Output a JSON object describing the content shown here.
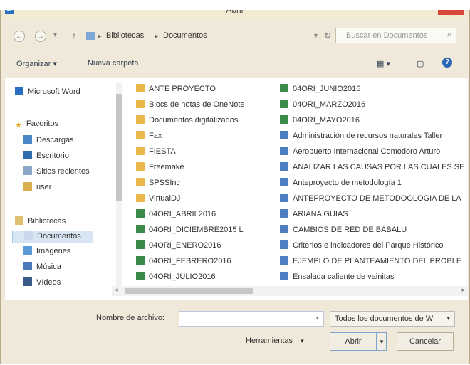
{
  "title": "Abrir",
  "breadcrumb": [
    "Bibliotecas",
    "Documentos"
  ],
  "search_placeholder": "Buscar en Documentos",
  "toolbar": {
    "organize": "Organizar ▾",
    "new_folder": "Nueva carpeta"
  },
  "nav": {
    "items": [
      {
        "label": "Microsoft Word",
        "icon": "word-icon"
      },
      {
        "label": "Favoritos",
        "icon": "star-icon"
      },
      {
        "label": "Descargas",
        "icon": "download-folder-icon"
      },
      {
        "label": "Escritorio",
        "icon": "desktop-icon"
      },
      {
        "label": "Sitios recientes",
        "icon": "recent-places-icon"
      },
      {
        "label": "user",
        "icon": "user-folder-icon"
      },
      {
        "label": "Bibliotecas",
        "icon": "library-icon"
      },
      {
        "label": "Documentos",
        "icon": "documents-icon"
      },
      {
        "label": "Imágenes",
        "icon": "pictures-icon"
      },
      {
        "label": "Música",
        "icon": "music-icon"
      },
      {
        "label": "Vídeos",
        "icon": "videos-icon"
      }
    ]
  },
  "files": {
    "col1": [
      {
        "name": "ANTE PROYECTO",
        "type": "folder"
      },
      {
        "name": "Blocs de notas de OneNote",
        "type": "folder"
      },
      {
        "name": "Documentos digitalizados",
        "type": "folder"
      },
      {
        "name": "Fax",
        "type": "folder"
      },
      {
        "name": "FIESTA",
        "type": "folder"
      },
      {
        "name": "Freemake",
        "type": "folder"
      },
      {
        "name": "SPSSInc",
        "type": "folder"
      },
      {
        "name": "VirtualDJ",
        "type": "folder"
      },
      {
        "name": "04ORI_ABRIL2016",
        "type": "xlsx"
      },
      {
        "name": "04ORI_DICIEMBRE2015 L",
        "type": "xlsx"
      },
      {
        "name": "04ORI_ENERO2016",
        "type": "xlsx"
      },
      {
        "name": "04ORI_FEBRERO2016",
        "type": "xlsx"
      },
      {
        "name": "04ORI_JULIO2016",
        "type": "xlsx"
      }
    ],
    "col2": [
      {
        "name": "04ORI_JUNIO2016",
        "type": "xlsx"
      },
      {
        "name": "04ORI_MARZO2016",
        "type": "xlsx"
      },
      {
        "name": "04ORI_MAYO2016",
        "type": "xlsx"
      },
      {
        "name": "Administración de recursos naturales Taller",
        "type": "docx"
      },
      {
        "name": "Aeropuerto Internacional Comodoro Arturo",
        "type": "docx"
      },
      {
        "name": "ANALIZAR LAS CAUSAS POR LAS CUALES SE",
        "type": "docx"
      },
      {
        "name": "Anteproyecto de metodología 1",
        "type": "docx"
      },
      {
        "name": "ANTEPROYECTO DE METODOOLOGIA DE LA",
        "type": "docx"
      },
      {
        "name": "ARIANA GUIAS",
        "type": "docx"
      },
      {
        "name": "CAMBIOS DE RED DE BABALU",
        "type": "docx"
      },
      {
        "name": "Criterios e indicadores del Parque Histórico",
        "type": "docx"
      },
      {
        "name": "EJEMPLO DE PLANTEAMIENTO DEL PROBLE",
        "type": "docx"
      },
      {
        "name": "Ensalada caliente de vainitas",
        "type": "docx"
      }
    ]
  },
  "filename_label": "Nombre de archivo:",
  "filename_value": "",
  "filter": "Todos los documentos de W",
  "tools": "Herramientas",
  "open_button": "Abrir",
  "cancel_button": "Cancelar"
}
